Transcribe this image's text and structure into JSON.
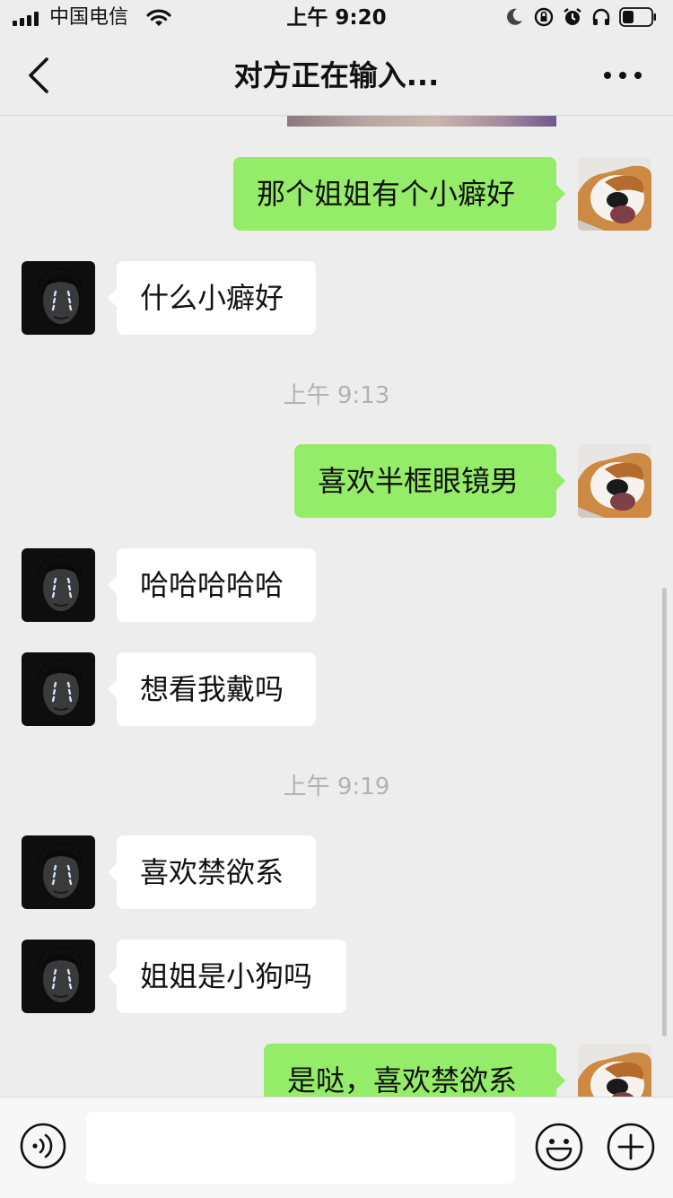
{
  "status_bar": {
    "carrier": "中国电信",
    "time": "上午 9:20"
  },
  "nav": {
    "title": "对方正在输入..."
  },
  "icons": {
    "back": "chevron-left-icon",
    "more": "more-dots-icon",
    "voice": "voice-icon",
    "emoji": "emoji-icon",
    "plus": "plus-icon"
  },
  "colors": {
    "outgoing_bubble": "#95ec69",
    "incoming_bubble": "#ffffff",
    "background": "#ededed"
  },
  "messages": [
    {
      "side": "out",
      "text": "那个姐姐有个小癖好"
    },
    {
      "side": "in",
      "text": "什么小癖好"
    },
    {
      "type": "timestamp",
      "text": "上午 9:13"
    },
    {
      "side": "out",
      "text": "喜欢半框眼镜男"
    },
    {
      "side": "in",
      "text": "哈哈哈哈哈"
    },
    {
      "side": "in",
      "text": "想看我戴吗"
    },
    {
      "type": "timestamp",
      "text": "上午 9:19"
    },
    {
      "side": "in",
      "text": "喜欢禁欲系"
    },
    {
      "side": "in",
      "text": "姐姐是小狗吗"
    },
    {
      "side": "out",
      "text": "是哒，喜欢禁欲系"
    }
  ],
  "input": {
    "value": "",
    "placeholder": ""
  }
}
